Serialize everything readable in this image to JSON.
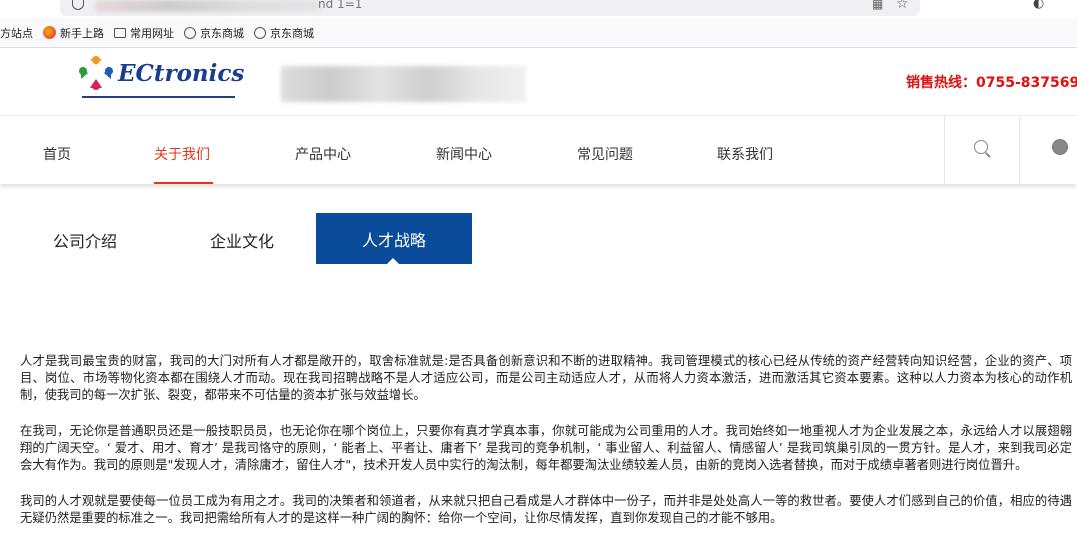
{
  "browser": {
    "url_tail": "nd 1=1",
    "bookmarks": [
      "方站点",
      "新手上路",
      "常用网址",
      "京东商城",
      "京东商城"
    ]
  },
  "header": {
    "logo_text": "ECtronics",
    "hotline": "销售热线：0755-837569"
  },
  "nav": {
    "items": [
      "首页",
      "关于我们",
      "产品中心",
      "新闻中心",
      "常见问题",
      "联系我们"
    ],
    "active": "关于我们"
  },
  "tabs": {
    "items": [
      "公司介绍",
      "企业文化",
      "人才战略"
    ],
    "active": "人才战略"
  },
  "content": {
    "paragraphs": [
      "人才是我司最宝贵的财富，我司的大门对所有人才都是敞开的，取舍标准就是:是否具备创新意识和不断的进取精神。我司管理模式的核心已经从传统的资产经营转向知识经营，企业的资产、项目、岗位、市场等物化资本都在围绕人才而动。现在我司招聘战略不是人才适应公司，而是公司主动适应人才，从而将人力资本激活，进而激活其它资本要素。这种以人力资本为核心的动作机制，使我司的每一次扩张、裂变，都带来不可估量的资本扩张与效益增长。",
      "在我司，无论你是普通职员还是一般技职员员，也无论你在哪个岗位上，只要你有真才学真本事，你就可能成为公司重用的人才。我司始终如一地重视人才为企业发展之本，永远给人才以展翅翱翔的广阔天空。‘ 爱才、用才、育才’ 是我司恪守的原则，‘ 能者上、平者让、庸者下’ 是我司的竞争机制，‘ 事业留人、利益留人、情感留人’ 是我司筑巢引凤的一贯方针。是人才，来到我司必定会大有作为。我司的原则是\"发现人才，清除庸才，留住人才\"，技术开发人员中实行的淘汰制，每年都要淘汰业绩较差人员，由新的竞岗入选者替换，而对于成绩卓著者则进行岗位晋升。",
      "我司的人才观就是要使每一位员工成为有用之才。我司的决策者和领道者，从来就只把自己看成是人才群体中一份子，而并非是处处高人一等的救世者。要使人才们感到自己的价值，相应的待遇无疑仍然是重要的标准之一。我司把需给所有人才的是这样一种广阔的胸怀：给你一个空间，让你尽情发挥，直到你发现自己的才能不够用。"
    ]
  },
  "colors": {
    "accent_red": "#e03a1e",
    "tab_blue": "#0a4b9a",
    "hotline_red": "#e01010"
  }
}
